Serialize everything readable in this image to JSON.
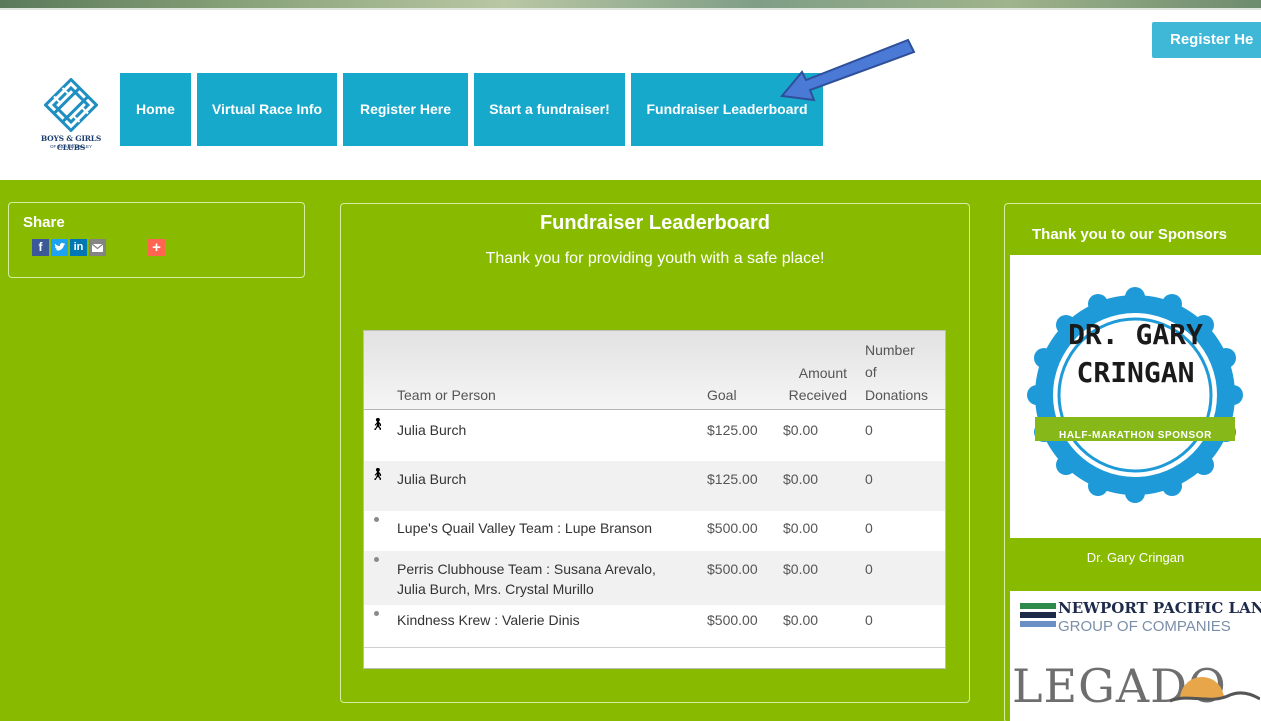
{
  "header": {
    "register_top_label": "Register He",
    "logo_text": "BOYS & GIRLS CLUBS",
    "logo_subtext": "OF INLAND VALLEY"
  },
  "nav": {
    "items": [
      {
        "label": "Home"
      },
      {
        "label": "Virtual Race Info"
      },
      {
        "label": "Register Here"
      },
      {
        "label": "Start a fundraiser!"
      },
      {
        "label": "Fundraiser Leaderboard"
      }
    ]
  },
  "share": {
    "title": "Share",
    "icons": [
      "facebook-icon",
      "twitter-icon",
      "linkedin-icon",
      "email-icon",
      "more-icon"
    ]
  },
  "leaderboard": {
    "title": "Fundraiser Leaderboard",
    "subtitle": "Thank you for providing youth with a safe place!",
    "columns": {
      "team": "Team or Person",
      "goal": "Goal",
      "amount_line1": "Amount",
      "amount_line2": "Received",
      "donations_line1": "Number",
      "donations_line2": "of",
      "donations_line3": "Donations"
    },
    "rows": [
      {
        "type": "person",
        "name": "Julia Burch",
        "name2": "",
        "goal": "$125.00",
        "received": "$0.00",
        "donations": "0"
      },
      {
        "type": "person",
        "name": "Julia Burch",
        "name2": "",
        "goal": "$125.00",
        "received": "$0.00",
        "donations": "0"
      },
      {
        "type": "team",
        "name": "Lupe's Quail Valley Team : Lupe Branson",
        "name2": "",
        "goal": "$500.00",
        "received": "$0.00",
        "donations": "0"
      },
      {
        "type": "team",
        "name": "Perris Clubhouse Team : Susana Arevalo,",
        "name2": "Julia Burch, Mrs. Crystal Murillo",
        "goal": "$500.00",
        "received": "$0.00",
        "donations": "0"
      },
      {
        "type": "team",
        "name": "Kindness Krew : Valerie Dinis",
        "name2": "",
        "goal": "$500.00",
        "received": "$0.00",
        "donations": "0"
      }
    ]
  },
  "sponsors": {
    "title": "Thank you to our Sponsors",
    "badge_line1": "DR. GARY",
    "badge_line2": "CRINGAN",
    "badge_ribbon": "HALF-MARATHON SPONSOR",
    "sponsor1_name": "Dr. Gary Cringan",
    "sponsor2_line1": "NEWPORT PACIFIC LAND",
    "sponsor2_line2": "GROUP OF COMPANIES",
    "sponsor3_text": "LEGADO"
  },
  "colors": {
    "nav_blue": "#17a9cc",
    "page_green": "#88bb00",
    "badge_blue": "#1e9ad8",
    "ribbon_green": "#86b81a"
  }
}
